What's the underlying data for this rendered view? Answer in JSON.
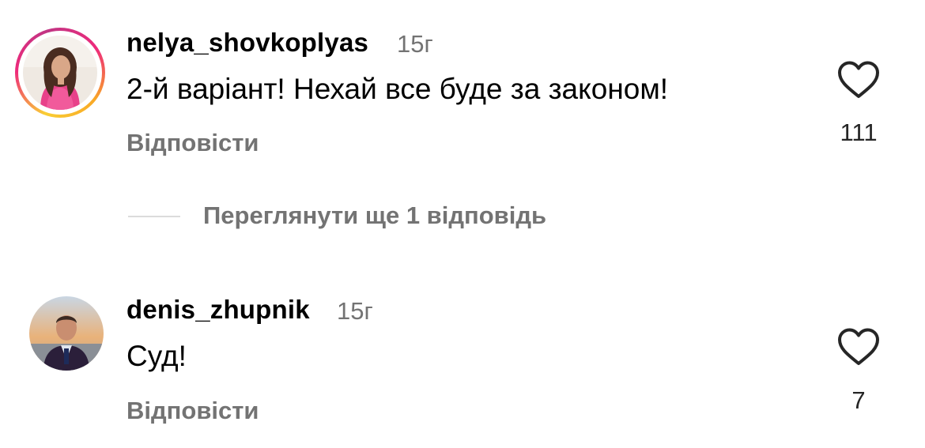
{
  "comments": [
    {
      "username": "nelya_shovkoplyas",
      "time": "15г",
      "text": "2-й варіант! Нехай все буде за законом!",
      "reply_label": "Відповісти",
      "likes": "111",
      "has_story_ring": true
    },
    {
      "username": "denis_zhupnik",
      "time": "15г",
      "text": "Суд!",
      "reply_label": "Відповісти",
      "likes": "7",
      "has_story_ring": false
    }
  ],
  "view_replies_label": "Переглянути ще 1 відповідь",
  "colors": {
    "primary_text": "#000000",
    "secondary_text": "#737373",
    "divider": "#dbdbdb",
    "story_ring_start": "#f9ce34",
    "story_ring_end": "#ee2a7b"
  },
  "icons": {
    "like": "heart-outline-icon"
  }
}
